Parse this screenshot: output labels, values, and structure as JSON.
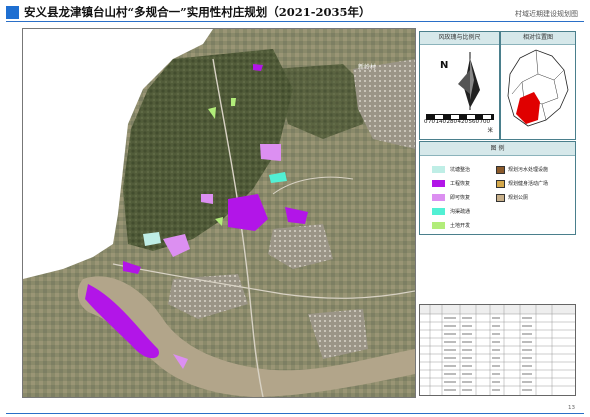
{
  "header": {
    "title": "安义县龙津镇台山村“多规合一”实用性村庄规划（2021-2035年）",
    "subtitle": "村域近期建设规划图"
  },
  "map": {
    "labels": [
      "新岭村"
    ]
  },
  "compass_panel": {
    "title": "风玫瑰与比例尺",
    "north": "N",
    "scale_labels": [
      "0",
      "70",
      "140",
      "280",
      "420",
      "560",
      "700"
    ],
    "unit": "米"
  },
  "location_panel": {
    "title": "相对位置图"
  },
  "legend": {
    "title": "图 例",
    "left_items": [
      {
        "label": "坑塘整治",
        "color": "#bfeee6"
      },
      {
        "label": "工程恢复",
        "color": "#b215e8"
      },
      {
        "label": "即可恢复",
        "color": "#dc8ff1"
      },
      {
        "label": "沟渠疏通",
        "color": "#52f0d4"
      },
      {
        "label": "土地开发",
        "color": "#b2ed7a"
      }
    ],
    "right_items": [
      {
        "label": "规划污水处理设施",
        "icon": "wastewater-facility-icon"
      },
      {
        "label": "规划健身活动广场",
        "icon": "fitness-plaza-icon"
      },
      {
        "label": "规划公厕",
        "icon": "public-toilet-icon"
      }
    ]
  },
  "page": {
    "number": "13"
  },
  "colors": {
    "accent": "#1f6fd1",
    "river": "#b2a58a",
    "purple": "#b215e8",
    "light_purple": "#dc8ff1",
    "mint": "#bfeee6",
    "cyan": "#52f0d4",
    "green": "#b2ed7a"
  }
}
